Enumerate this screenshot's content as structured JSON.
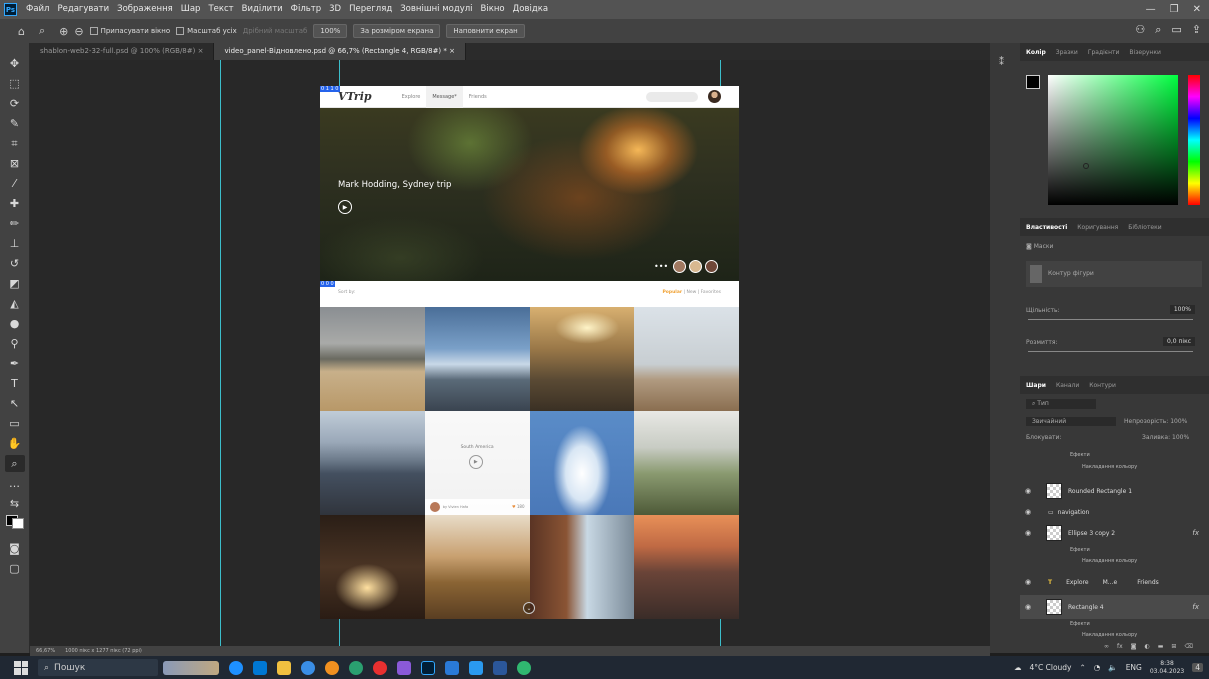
{
  "menubar": {
    "logo": "Ps",
    "items": [
      "Файл",
      "Редагувати",
      "Зображення",
      "Шар",
      "Текст",
      "Виділити",
      "Фільтр",
      "3D",
      "Перегляд",
      "Зовнішні модулі",
      "Вікно",
      "Довідка"
    ]
  },
  "options": {
    "fit_window": "Припасувати вікно",
    "zoom_all": "Масштаб усіх",
    "fine_zoom": "Дрібний масштаб",
    "zoom_value": "100%",
    "fit_screen": "За розміром екрана",
    "fill_screen": "Наповнити екран"
  },
  "tabs": [
    "shablon-web2-32-full.psd @ 100% (RGB/8#)",
    "video_panel-Відновлено.psd @ 66,7% (Rectangle 4, RGB/8#) *"
  ],
  "site": {
    "logo": "VTrip",
    "nav": [
      "Explore",
      "Message*",
      "Friends"
    ],
    "hero_title": "Mark Hodding, Sydney trip",
    "sort_label": "Sort by:",
    "sort_active": "Popular",
    "sort_rest": "| New | Favorites",
    "card_title": "South America",
    "card_user": "by Vivien Hafa",
    "card_likes": "180",
    "sel_label_1": "0 1 1 0",
    "sel_label_2": "0 0 0"
  },
  "panels": {
    "color_tabs": [
      "Колір",
      "Зразки",
      "Градієнти",
      "Візерунки"
    ],
    "prop_tabs": [
      "Властивості",
      "Коригування",
      "Бібліотеки"
    ],
    "masks_label": "Маски",
    "shape_mask": "Контур фігури",
    "density_label": "Щільність:",
    "density_value": "100%",
    "feather_label": "Розмиття:",
    "feather_value": "0,0 пікс",
    "layer_tabs": [
      "Шари",
      "Канали",
      "Контури"
    ],
    "filter_kind": "Тип",
    "blend_mode": "Звичайний",
    "opacity_label": "Непрозорість:",
    "opacity_value": "100%",
    "lock_label": "Блокувати:",
    "fill_label": "Заливка:",
    "fill_value": "100%",
    "layers": {
      "effects": "Ефекти",
      "color_overlay": "Накладання кольору",
      "rounded_rect": "Rounded Rectangle 1",
      "navigation": "navigation",
      "ellipse": "Ellipse 3 copy 2",
      "text_explore": "Explore",
      "text_m": "M...e",
      "text_friends": "Friends",
      "rect4": "Rectangle 4",
      "fx": "fx"
    }
  },
  "status": {
    "zoom": "66,67%",
    "dims": "1000 пікс x 1277 пікс (72 ppi)"
  },
  "taskbar": {
    "search": "Пошук",
    "weather": "4°C Cloudy",
    "lang": "ENG",
    "time": "8:38",
    "date": "03.04.2023",
    "notif": "4"
  }
}
